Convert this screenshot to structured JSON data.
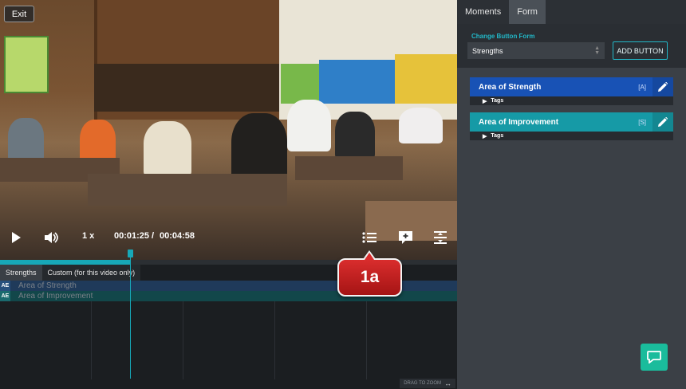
{
  "window": {
    "exit_label": "Exit"
  },
  "player": {
    "speed": "1 x",
    "current_time": "00:01:25",
    "separator": "/",
    "duration": "00:04:58",
    "progress_fraction": 0.285
  },
  "timeline": {
    "tabs": [
      "Strengths",
      "Custom (for this video only)"
    ],
    "rows": [
      {
        "badge": "AE",
        "label": "Area of Strength",
        "color": "#1f3a5a"
      },
      {
        "badge": "AE",
        "label": "Area of Improvement",
        "color": "#12474a"
      }
    ],
    "drag_to_zoom": "DRAG TO ZOOM"
  },
  "callout": {
    "label": "1a"
  },
  "panel": {
    "tabs": [
      "Moments",
      "Form"
    ],
    "active_tab": "Form",
    "form_label": "Change Button Form",
    "selected_form": "Strengths",
    "add_button_label": "ADD BUTTON",
    "buttons": [
      {
        "name": "Area of Strength",
        "key": "[A]",
        "color": "#1852b5",
        "tags_label": "Tags"
      },
      {
        "name": "Area of Improvement",
        "key": "[S]",
        "color": "#169aa6",
        "tags_label": "Tags"
      }
    ]
  },
  "colors": {
    "accent": "#17a8b8",
    "callout": "#c41f1f",
    "chat": "#1abc9c"
  }
}
